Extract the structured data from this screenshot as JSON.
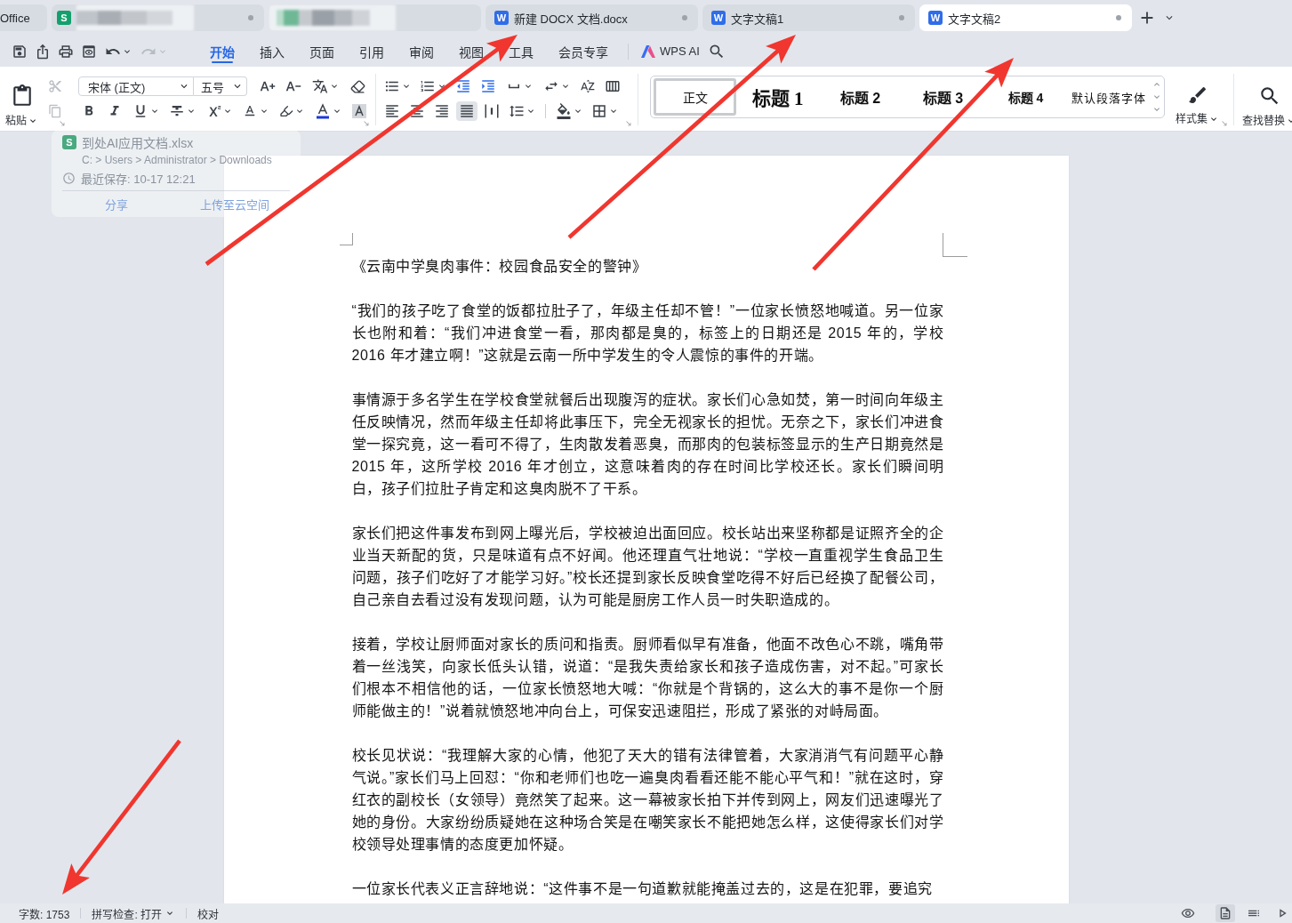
{
  "tabs": [
    {
      "kind": "home",
      "title": "Office",
      "selected": false,
      "dot": false
    },
    {
      "kind": "blurred",
      "icon": "S",
      "color": "#14a06c",
      "selected": false,
      "dot": true
    },
    {
      "kind": "blurred",
      "selected": false,
      "dot": false
    },
    {
      "kind": "document",
      "icon": "W",
      "color": "#2f6de9",
      "title": "新建 DOCX 文档.docx",
      "selected": false,
      "dot": true
    },
    {
      "kind": "document",
      "icon": "W",
      "color": "#2f6de9",
      "title": "文字文稿1",
      "selected": false,
      "dot": true
    },
    {
      "kind": "document",
      "icon": "W",
      "color": "#2f6de9",
      "title": "文字文稿2",
      "selected": true,
      "dot": true
    }
  ],
  "quick_access": [
    {
      "kind": "save",
      "disabled": false
    },
    {
      "kind": "export",
      "disabled": false
    },
    {
      "kind": "print",
      "disabled": false
    },
    {
      "kind": "preview",
      "disabled": false
    },
    {
      "kind": "undo",
      "disabled": false
    },
    {
      "kind": "redo",
      "disabled": true
    }
  ],
  "menu": [
    {
      "label": "开始",
      "selected": true
    },
    {
      "label": "插入",
      "selected": false
    },
    {
      "label": "页面",
      "selected": false
    },
    {
      "label": "引用",
      "selected": false
    },
    {
      "label": "审阅",
      "selected": false
    },
    {
      "label": "视图",
      "selected": false
    },
    {
      "label": "工具",
      "selected": false
    },
    {
      "label": "会员专享",
      "selected": false
    }
  ],
  "ai_button": {
    "label": "WPS AI"
  },
  "ribbon": {
    "paste": {
      "label": "粘贴"
    },
    "clipboard": [
      {
        "kind": "cut",
        "disabled": true
      },
      {
        "kind": "copy",
        "disabled": true
      }
    ],
    "font": {
      "name": "宋体 (正文)",
      "size": "五号"
    },
    "alignment": [
      {
        "kind": "left",
        "selected": false
      },
      {
        "kind": "center",
        "selected": false
      },
      {
        "kind": "right",
        "selected": false
      },
      {
        "kind": "justify",
        "selected": true
      },
      {
        "kind": "distributed",
        "selected": false
      }
    ],
    "styles": [
      {
        "kind": "normal",
        "label": "正文",
        "selected": true
      },
      {
        "kind": "h1",
        "label": "标题 1",
        "selected": false
      },
      {
        "kind": "h2",
        "label": "标题 2",
        "selected": false
      },
      {
        "kind": "h3",
        "label": "标题 3",
        "selected": false
      },
      {
        "kind": "h4",
        "label": "标题 4",
        "selected": false
      },
      {
        "kind": "char",
        "label": "默认段落字体",
        "selected": false
      }
    ],
    "style_set": {
      "label": "样式集"
    },
    "find_replace": {
      "label": "查找替换"
    }
  },
  "popup": {
    "icon": "S",
    "file": "到处AI应用文档.xlsx",
    "path": "C: > Users > Administrator > Downloads",
    "saved": "最近保存: 10-17 12:21",
    "actions": [
      "分享",
      "上传至云空间"
    ]
  },
  "document": {
    "paragraphs": [
      "《云南中学臭肉事件：校园食品安全的警钟》",
      "“我们的孩子吃了食堂的饭都拉肚子了，年级主任却不管！”一位家长愤怒地喊道。另一位家长也附和着：“我们冲进食堂一看，那肉都是臭的，标签上的日期还是 2015 年的，学校 2016 年才建立啊！”这就是云南一所中学发生的令人震惊的事件的开端。",
      "事情源于多名学生在学校食堂就餐后出现腹泻的症状。家长们心急如焚，第一时间向年级主任反映情况，然而年级主任却将此事压下，完全无视家长的担忧。无奈之下，家长们冲进食堂一探究竟，这一看可不得了，生肉散发着恶臭，而那肉的包装标签显示的生产日期竟然是 2015 年，这所学校 2016 年才创立，这意味着肉的存在时间比学校还长。家长们瞬间明白，孩子们拉肚子肯定和这臭肉脱不了干系。",
      "家长们把这件事发布到网上曝光后，学校被迫出面回应。校长站出来坚称都是证照齐全的企业当天新配的货，只是味道有点不好闻。他还理直气壮地说：“学校一直重视学生食品卫生问题，孩子们吃好了才能学习好。”校长还提到家长反映食堂吃得不好后已经换了配餐公司，自己亲自去看过没有发现问题，认为可能是厨房工作人员一时失职造成的。",
      "接着，学校让厨师面对家长的质问和指责。厨师看似早有准备，他面不改色心不跳，嘴角带着一丝浅笑，向家长低头认错，说道：“是我失责给家长和孩子造成伤害，对不起。”可家长们根本不相信他的话，一位家长愤怒地大喊：“你就是个背锅的，这么大的事不是你一个厨师能做主的！”说着就愤怒地冲向台上，可保安迅速阻拦，形成了紧张的对峙局面。",
      "校长见状说：“我理解大家的心情，他犯了天大的错有法律管着，大家消消气有问题平心静气说。”家长们马上回怼：“你和老师们也吃一遍臭肉看看还能不能心平气和！”就在这时，穿红衣的副校长（女领导）竟然笑了起来。这一幕被家长拍下并传到网上，网友们迅速曝光了她的身份。大家纷纷质疑她在这种场合笑是在嘲笑家长不能把她怎么样，这使得家长们对学校领导处理事情的态度更加怀疑。",
      "一位家长代表义正言辞地说：“这件事不是一句道歉就能掩盖过去的，这是在犯罪，要追究"
    ]
  },
  "status_bar": {
    "word_count": "字数: 1753",
    "spell_check": "拼写检查: 打开",
    "proofread": "校对",
    "views": [
      {
        "kind": "eye",
        "selected": false
      },
      {
        "kind": "page",
        "selected": true
      },
      {
        "kind": "outline",
        "selected": false
      },
      {
        "kind": "play",
        "selected": false
      }
    ]
  }
}
